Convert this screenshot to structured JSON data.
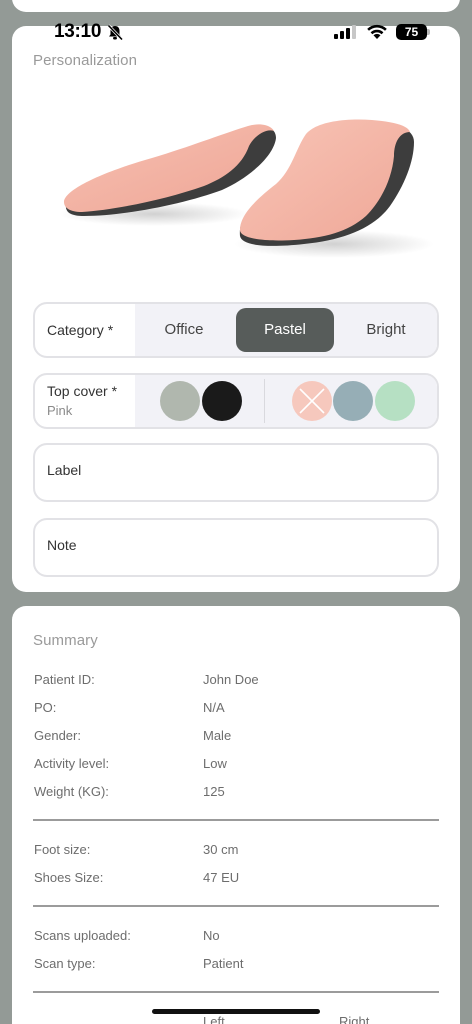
{
  "status_bar": {
    "time": "13:10",
    "battery": "75"
  },
  "personalization": {
    "title": "Personalization",
    "category": {
      "label": "Category *",
      "options": [
        "Office",
        "Pastel",
        "Bright"
      ],
      "selected": "Pastel"
    },
    "top_cover": {
      "label": "Top cover *",
      "value": "Pink",
      "swatches": [
        {
          "name": "sage",
          "color": "#b0b7ae"
        },
        {
          "name": "black",
          "color": "#1a1a1a"
        },
        {
          "name": "pink",
          "color": "#f6c8bd",
          "selected": true
        },
        {
          "name": "blue-grey",
          "color": "#96aeb6"
        },
        {
          "name": "mint",
          "color": "#b6e0c3"
        }
      ]
    },
    "label_field": {
      "placeholder": "Label"
    },
    "note_field": {
      "placeholder": "Note"
    }
  },
  "summary": {
    "title": "Summary",
    "group1": [
      {
        "key": "Patient ID:",
        "value": "John Doe"
      },
      {
        "key": "PO:",
        "value": "N/A"
      },
      {
        "key": "Gender:",
        "value": "Male"
      },
      {
        "key": "Activity level:",
        "value": "Low"
      },
      {
        "key": "Weight (KG):",
        "value": "125"
      }
    ],
    "group2": [
      {
        "key": "Foot size:",
        "value": "30 cm"
      },
      {
        "key": "Shoes Size:",
        "value": "47 EU"
      }
    ],
    "group3": [
      {
        "key": "Scans uploaded:",
        "value": "No"
      },
      {
        "key": "Scan type:",
        "value": "Patient"
      }
    ],
    "partial_headers": [
      "Left",
      "Right"
    ]
  },
  "colors": {
    "background": "#939a96",
    "selected_segment": "#575c5a",
    "insole_top": "#f5b4a4",
    "insole_base": "#3d3d3d"
  }
}
